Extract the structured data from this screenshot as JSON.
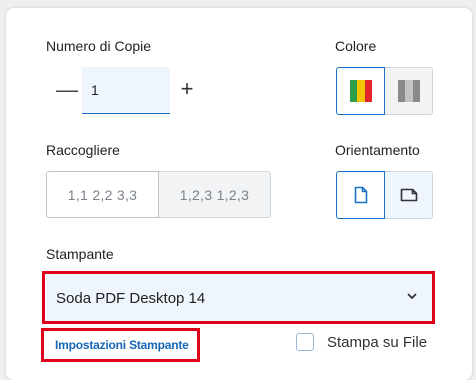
{
  "copies": {
    "label": "Numero di Copie",
    "value": "1",
    "minus_symbol": "—",
    "plus_symbol": "+"
  },
  "color": {
    "label": "Colore",
    "options": [
      "color-bars-icon",
      "grayscale-bars-icon"
    ],
    "selected": "color",
    "swatch_colors": [
      "#2e9e4b",
      "#f5c400",
      "#e0262a"
    ],
    "gray_colors": [
      "#8a8a8a",
      "#c4c4c4",
      "#8a8a8a"
    ]
  },
  "collate": {
    "label": "Raccogliere",
    "option_1": "1,1 2,2 3,3",
    "option_2": "1,2,3 1,2,3",
    "selected": "option_1"
  },
  "orientation": {
    "label": "Orientamento",
    "options": [
      "portrait-icon",
      "landscape-icon"
    ],
    "selected": "portrait"
  },
  "printer": {
    "label": "Stampante",
    "selected": "Soda PDF Desktop 14",
    "settings_link": "Impostazioni Stampante",
    "print_to_file_label": "Stampa su File",
    "print_to_file_checked": false
  },
  "colors": {
    "accent": "#1a73c9",
    "highlight_outline": "#e0001b",
    "link": "#1767b6"
  }
}
